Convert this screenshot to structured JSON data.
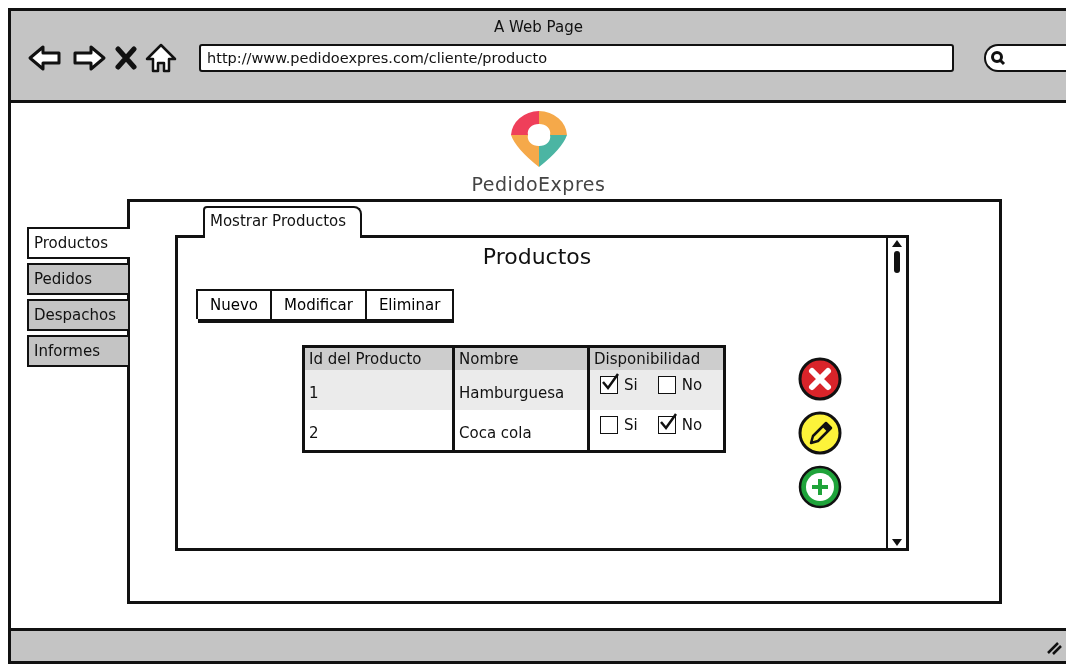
{
  "window": {
    "title": "A Web Page",
    "url": "http://www.pedidoexpres.com/cliente/producto"
  },
  "logo": {
    "text": "PedidoExpres"
  },
  "side_tabs": [
    {
      "label": "Productos",
      "selected": true
    },
    {
      "label": "Pedidos",
      "selected": false
    },
    {
      "label": "Despachos",
      "selected": false
    },
    {
      "label": "Informes",
      "selected": false
    }
  ],
  "panel_tab": {
    "label": "Mostrar Productos"
  },
  "heading": "Productos",
  "toolbar": [
    "Nuevo",
    "Modificar",
    "Eliminar"
  ],
  "table": {
    "columns": [
      "Id del Producto",
      "Nombre",
      "Disponibilidad"
    ],
    "rows": [
      {
        "id": "1",
        "name": "Hamburguesa",
        "options": [
          {
            "label": "Si",
            "checked": true
          },
          {
            "label": "No",
            "checked": false
          }
        ]
      },
      {
        "id": "2",
        "name": "Coca cola",
        "options": [
          {
            "label": "Si",
            "checked": false
          },
          {
            "label": "No",
            "checked": true
          }
        ]
      }
    ]
  },
  "actions": [
    {
      "kind": "delete"
    },
    {
      "kind": "edit"
    },
    {
      "kind": "add"
    }
  ]
}
